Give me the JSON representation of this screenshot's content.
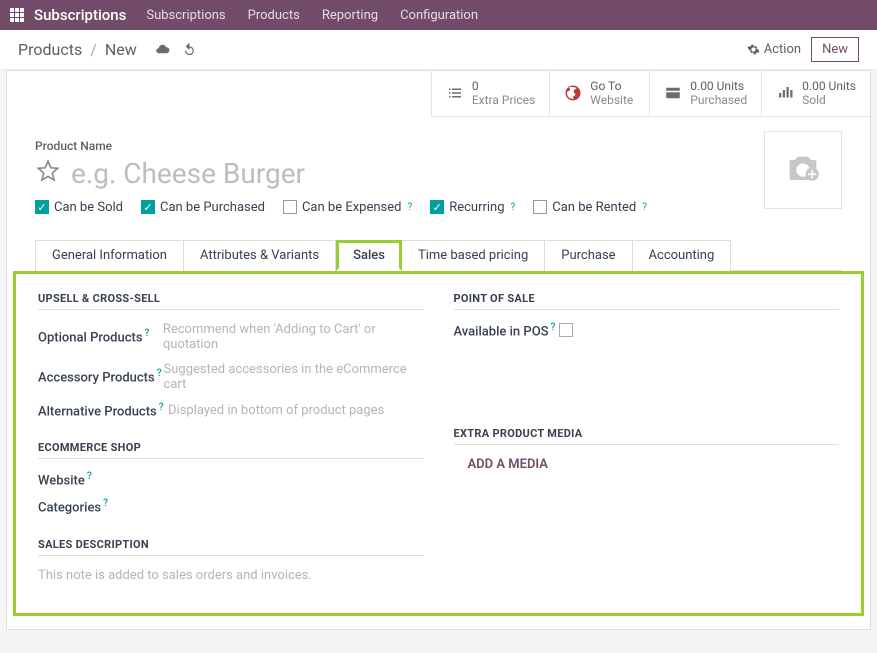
{
  "topbar": {
    "app_title": "Subscriptions",
    "menus": [
      "Subscriptions",
      "Products",
      "Reporting",
      "Configuration"
    ]
  },
  "controlbar": {
    "crumb_root": "Products",
    "crumb_current": "New",
    "action_label": "Action",
    "new_label": "New"
  },
  "stat_buttons": {
    "extra_prices": {
      "value": "0",
      "label": "Extra Prices"
    },
    "go_to_website": {
      "line1": "Go To",
      "line2": "Website"
    },
    "purchased": {
      "value": "0.00 Units",
      "label": "Purchased"
    },
    "sold": {
      "value": "0.00 Units",
      "label": "Sold"
    }
  },
  "product": {
    "name_label": "Product Name",
    "name_placeholder": "e.g. Cheese Burger",
    "checks": {
      "sold": "Can be Sold",
      "purchased": "Can be Purchased",
      "expensed": "Can be Expensed",
      "recurring": "Recurring",
      "rented": "Can be Rented"
    }
  },
  "tabs": [
    "General Information",
    "Attributes & Variants",
    "Sales",
    "Time based pricing",
    "Purchase",
    "Accounting"
  ],
  "sales_tab": {
    "upsell_title": "UPSELL & CROSS-SELL",
    "optional_label": "Optional Products",
    "optional_ph": "Recommend when 'Adding to Cart' or quotation",
    "accessory_label": "Accessory Products",
    "accessory_ph": "Suggested accessories in the eCommerce cart",
    "alternative_label": "Alternative Products",
    "alternative_ph": "Displayed in bottom of product pages",
    "pos_title": "POINT OF SALE",
    "pos_avail": "Available in POS",
    "ecom_title": "ECOMMERCE SHOP",
    "website_label": "Website",
    "categories_label": "Categories",
    "media_title": "EXTRA PRODUCT MEDIA",
    "add_media": "ADD A MEDIA",
    "desc_title": "SALES DESCRIPTION",
    "desc_ph": "This note is added to sales orders and invoices."
  }
}
